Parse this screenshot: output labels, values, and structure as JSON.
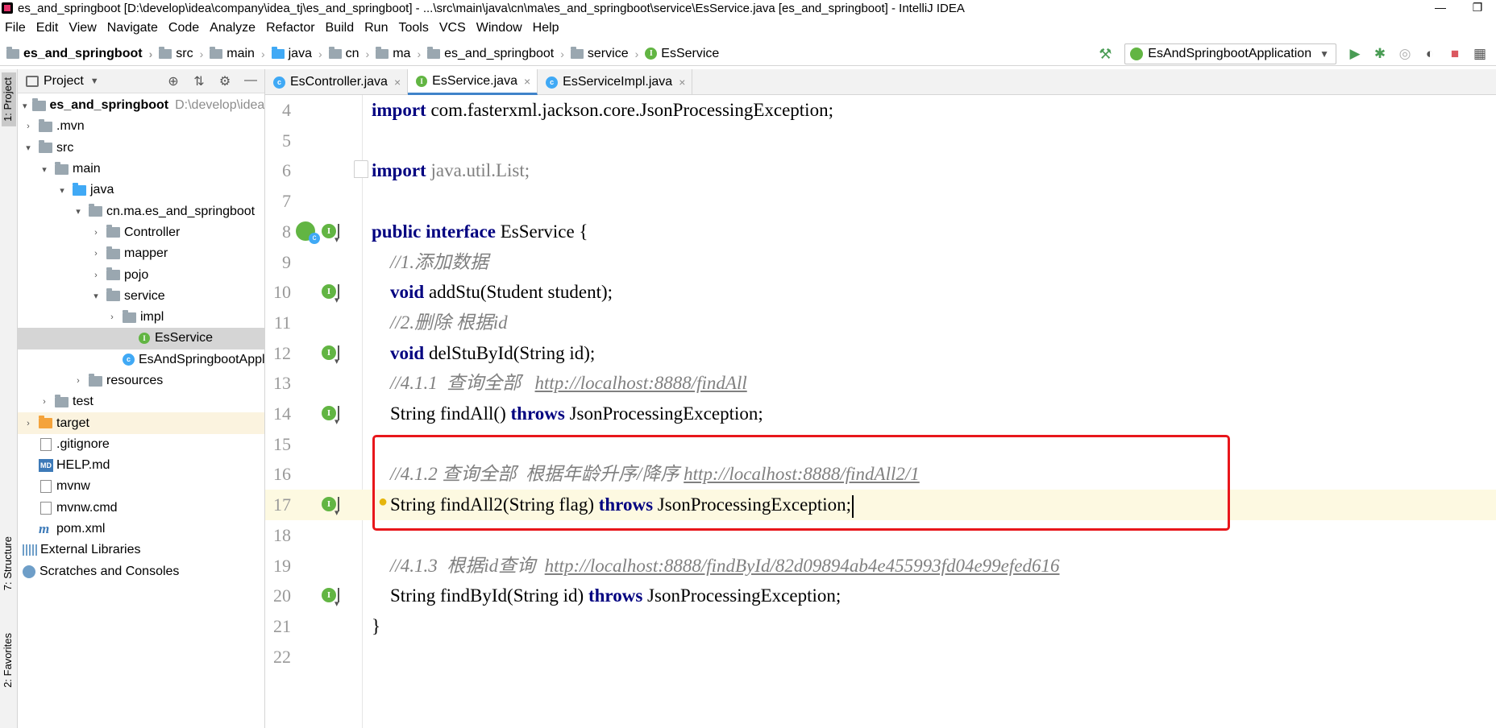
{
  "window": {
    "title": "es_and_springboot [D:\\develop\\idea\\company\\idea_tj\\es_and_springboot] - ...\\src\\main\\java\\cn\\ma\\es_and_springboot\\service\\EsService.java [es_and_springboot] - IntelliJ IDEA",
    "minimize": "—",
    "restore": "❐"
  },
  "menu": [
    "File",
    "Edit",
    "View",
    "Navigate",
    "Code",
    "Analyze",
    "Refactor",
    "Build",
    "Run",
    "Tools",
    "VCS",
    "Window",
    "Help"
  ],
  "breadcrumb": [
    "es_and_springboot",
    "src",
    "main",
    "java",
    "cn",
    "ma",
    "es_and_springboot",
    "service",
    "EsService"
  ],
  "run_config": "EsAndSpringbootApplication",
  "side_tabs": {
    "project": "1: Project",
    "structure": "7: Structure",
    "favorites": "2: Favorites"
  },
  "project_panel": {
    "title": "Project",
    "tree": [
      {
        "label": "es_and_springboot",
        "path": "D:\\develop\\idea\\c"
      },
      {
        "label": ".mvn"
      },
      {
        "label": "src"
      },
      {
        "label": "main"
      },
      {
        "label": "java"
      },
      {
        "label": "cn.ma.es_and_springboot"
      },
      {
        "label": "Controller"
      },
      {
        "label": "mapper"
      },
      {
        "label": "pojo"
      },
      {
        "label": "service"
      },
      {
        "label": "impl"
      },
      {
        "label": "EsService"
      },
      {
        "label": "EsAndSpringbootApplication"
      },
      {
        "label": "resources"
      },
      {
        "label": "test"
      },
      {
        "label": "target"
      },
      {
        "label": ".gitignore"
      },
      {
        "label": "HELP.md"
      },
      {
        "label": "mvnw"
      },
      {
        "label": "mvnw.cmd"
      },
      {
        "label": "pom.xml"
      },
      {
        "label": "External Libraries"
      },
      {
        "label": "Scratches and Consoles"
      }
    ]
  },
  "tabs": [
    {
      "label": "EsController.java"
    },
    {
      "label": "EsService.java"
    },
    {
      "label": "EsServiceImpl.java"
    }
  ],
  "editor": {
    "line_numbers": [
      "4",
      "5",
      "6",
      "7",
      "8",
      "9",
      "10",
      "11",
      "12",
      "13",
      "14",
      "15",
      "16",
      "17",
      "18",
      "19",
      "20",
      "21",
      "22"
    ],
    "code": {
      "l4_kw": "import",
      "l4_rest": " com.fasterxml.jackson.core.JsonProcessingException;",
      "l6_kw": "import",
      "l6_rest": " java.util.List;",
      "l8_kw1": "public",
      "l8_kw2": "interface",
      "l8_rest": " EsService {",
      "l9": "    //1.添加数据",
      "l10_kw": "void",
      "l10_rest": " addStu(Student student);",
      "l11": "    //2.删除 根据id",
      "l12_kw": "void",
      "l12_rest": " delStuById(String id);",
      "l13_comment": "    //4.1.1  查询全部   ",
      "l13_url": "http://localhost:8888/findAll",
      "l14_pre": "    String findAll() ",
      "l14_kw": "throws",
      "l14_rest": " JsonProcessingException;",
      "l16_comment": "    //4.1.2 查询全部  根据年龄升序/降序 ",
      "l16_url": "http://localhost:8888/findAll2/1",
      "l17_pre": "    String findAll2(String flag) ",
      "l17_kw": "throws",
      "l17_rest": " JsonProcessingException;",
      "l19_comment": "    //4.1.3  根据id查询  ",
      "l19_url": "http://localhost:8888/findById/82d09894ab4e455993fd04e99efed616",
      "l20_pre": "    String findById(String id) ",
      "l20_kw": "throws",
      "l20_rest": " JsonProcessingException;",
      "l21": "}"
    },
    "current_line": "17"
  },
  "colors": {
    "keyword": "#000080",
    "comment": "#808080",
    "highlight_box": "#e8161b",
    "current_line": "#fdf9e1",
    "interface_badge": "#62b543"
  }
}
